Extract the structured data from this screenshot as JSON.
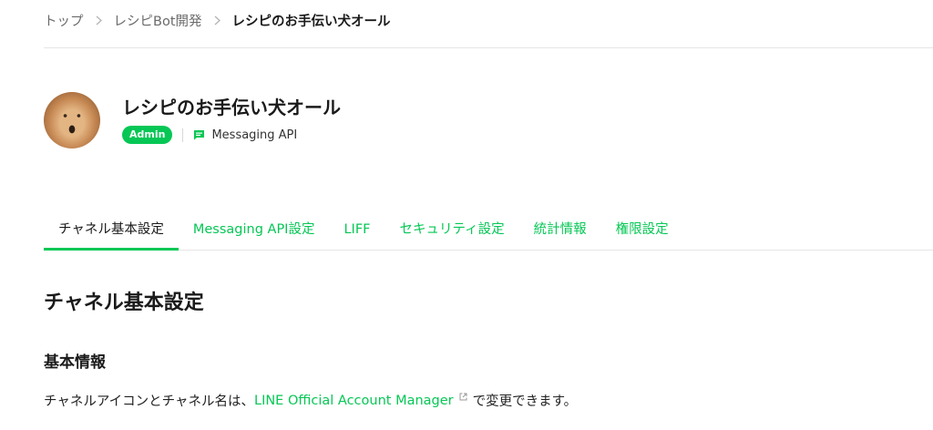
{
  "breadcrumb": {
    "items": [
      "トップ",
      "レシピBot開発"
    ],
    "current": "レシピのお手伝い犬オール"
  },
  "channel": {
    "name": "レシピのお手伝い犬オール",
    "role_badge": "Admin",
    "type": "Messaging API",
    "avatar": "dog-avatar"
  },
  "tabs": [
    {
      "label": "チャネル基本設定",
      "active": true
    },
    {
      "label": "Messaging API設定",
      "active": false
    },
    {
      "label": "LIFF",
      "active": false
    },
    {
      "label": "セキュリティ設定",
      "active": false
    },
    {
      "label": "統計情報",
      "active": false
    },
    {
      "label": "権限設定",
      "active": false
    }
  ],
  "main": {
    "title": "チャネル基本設定",
    "section_title": "基本情報",
    "desc_prefix": "チャネルアイコンとチャネル名は、",
    "desc_link": "LINE Official Account Manager",
    "desc_suffix": "で変更できます。"
  },
  "colors": {
    "accent": "#06c755",
    "text": "#1a1a1a",
    "muted": "#6a6a6a",
    "border": "#e6e6e6"
  },
  "icons": [
    "chevron-right-icon",
    "chat-bubble-icon",
    "external-link-icon"
  ]
}
